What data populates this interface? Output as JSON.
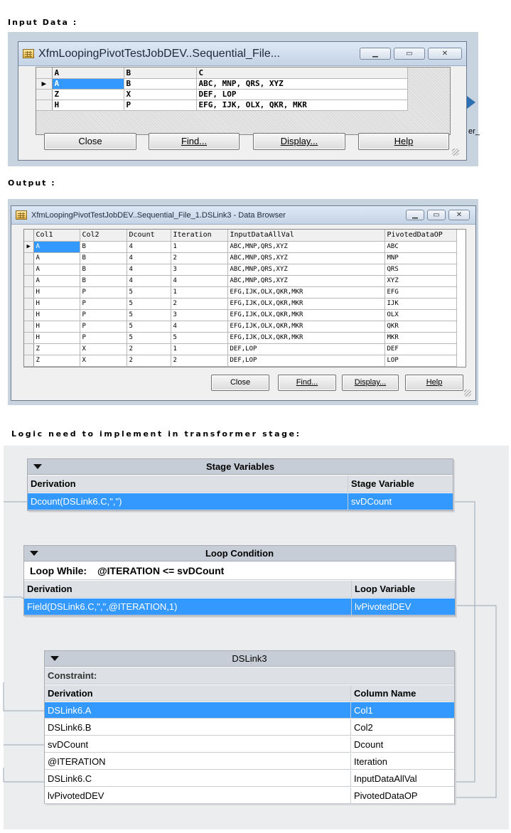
{
  "headings": {
    "input": "Input Data :",
    "output": "Output :",
    "logic": "Logic need to implement in transformer stage:"
  },
  "input_window": {
    "title": "XfmLoopingPivotTestJobDEV..Sequential_File...",
    "columns": [
      "A",
      "B",
      "C"
    ],
    "rows": [
      [
        "A",
        "B",
        "ABC, MNP, QRS, XYZ"
      ],
      [
        "Z",
        "X",
        "DEF, LOP"
      ],
      [
        "H",
        "P",
        "EFG, IJK, OLX, QKR, MKR"
      ]
    ],
    "buttons": {
      "close": "Close",
      "find": "Find...",
      "display": "Display...",
      "help": "Help"
    },
    "side_fragment": "er_"
  },
  "output_window": {
    "title": "XfmLoopingPivotTestJobDEV..Sequential_File_1.DSLink3 - Data Browser",
    "columns": [
      "Col1",
      "Col2",
      "Dcount",
      "Iteration",
      "InputDataAllVal",
      "PivotedDataOP"
    ],
    "rows": [
      [
        "A",
        "B",
        "4",
        "1",
        "ABC,MNP,QRS,XYZ",
        "ABC"
      ],
      [
        "A",
        "B",
        "4",
        "2",
        "ABC,MNP,QRS,XYZ",
        "MNP"
      ],
      [
        "A",
        "B",
        "4",
        "3",
        "ABC,MNP,QRS,XYZ",
        "QRS"
      ],
      [
        "A",
        "B",
        "4",
        "4",
        "ABC,MNP,QRS,XYZ",
        "XYZ"
      ],
      [
        "H",
        "P",
        "5",
        "1",
        "EFG,IJK,OLX,QKR,MKR",
        "EFG"
      ],
      [
        "H",
        "P",
        "5",
        "2",
        "EFG,IJK,OLX,QKR,MKR",
        "IJK"
      ],
      [
        "H",
        "P",
        "5",
        "3",
        "EFG,IJK,OLX,QKR,MKR",
        "OLX"
      ],
      [
        "H",
        "P",
        "5",
        "4",
        "EFG,IJK,OLX,QKR,MKR",
        "QKR"
      ],
      [
        "H",
        "P",
        "5",
        "5",
        "EFG,IJK,OLX,QKR,MKR",
        "MKR"
      ],
      [
        "Z",
        "X",
        "2",
        "1",
        "DEF,LOP",
        "DEF"
      ],
      [
        "Z",
        "X",
        "2",
        "2",
        "DEF,LOP",
        "LOP"
      ]
    ],
    "buttons": {
      "close": "Close",
      "find": "Find...",
      "display": "Display...",
      "help": "Help"
    }
  },
  "stage_variables": {
    "title": "Stage Variables",
    "col_derivation": "Derivation",
    "col_name": "Stage Variable",
    "rows": [
      {
        "derivation": "Dcount(DSLink6.C,\",\")",
        "name": "svDCount"
      }
    ]
  },
  "loop_condition": {
    "title": "Loop Condition",
    "while_label": "Loop While:",
    "while_expr": "@ITERATION <= svDCount",
    "col_derivation": "Derivation",
    "col_name": "Loop Variable",
    "rows": [
      {
        "derivation": "Field(DSLink6.C,\",\",@ITERATION,1)",
        "name": "lvPivotedDEV"
      }
    ]
  },
  "dslink3": {
    "title": "DSLink3",
    "constraint_label": "Constraint:",
    "col_derivation": "Derivation",
    "col_name": "Column Name",
    "rows": [
      {
        "derivation": "DSLink6.A",
        "name": "Col1"
      },
      {
        "derivation": "DSLink6.B",
        "name": "Col2"
      },
      {
        "derivation": "svDCount",
        "name": "Dcount"
      },
      {
        "derivation": "@ITERATION",
        "name": "Iteration"
      },
      {
        "derivation": "DSLink6.C",
        "name": "InputDataAllVal"
      },
      {
        "derivation": "lvPivotedDEV",
        "name": "PivotedDataOP"
      }
    ]
  },
  "colors": {
    "selection": "#3399ff",
    "panel_header": "#c6cdd6",
    "column_header": "#dde1e6"
  }
}
